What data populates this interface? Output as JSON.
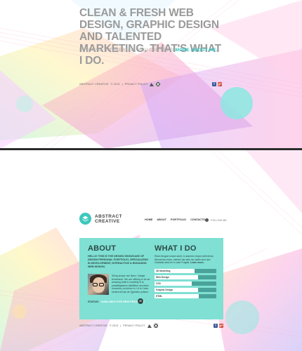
{
  "hero": {
    "headline": "CLEAN & FRESH WEB DESIGN, GRAPHIC DESIGN AND TALENTED MARKETING. THAT'S WHAT I DO.",
    "subline_prefix": "IF YOU'RE INTERESTED, YOU CAN READ",
    "subline_link": "MORE ABOUT ME."
  },
  "footer": {
    "copyright": "ABSTRACT CREATIVE",
    "year": "© 2013",
    "separator": "|",
    "privacy": "PRIVACY POLICY"
  },
  "social": {
    "facebook": "f",
    "googleplus": "g+"
  },
  "logo": {
    "line1": "ABSTRACT",
    "line2": "CREATIVE"
  },
  "nav": {
    "items": [
      "HOME",
      "ABOUT",
      "PORTFOLIO",
      "CONTACTS"
    ],
    "follow": "FOLLOW ME"
  },
  "about": {
    "title": "ABOUT",
    "intro": "HELLO! THIS IS THE DESIGN SHOWCASE OF DESIGN PERSONAL PORTFOLIO, SPECIALIZING IN DEVELOPMENT, INTERACTIVE & ENGAGING WEB DESIGN.",
    "bio": "Sit/ng ac/que nis/ libero. Integer fermentum. We are offering to be an amazing artist & creativity is to pariatlllgasbem debilitium sed diam nonummy od dolore in. Ut to Carta sentencia has de Qgestion pulsem.",
    "status_label": "STATUS:",
    "status_value": "AVAILABLE FOR NEW PROJECTS"
  },
  "whatido": {
    "title": "WHAT I DO",
    "text": "Etiam feugiat ornare amet, & assentor dopen delenti dui Nismat lae blues, claritmi nar ettur tao ladiln sum Ipsi Claritatsl albui ter in ante Fragilis.",
    "more": "Learn more..",
    "skills": [
      {
        "label": "3D Modelling",
        "value": 0.65
      },
      {
        "label": "Web Design",
        "value": 0.7
      },
      {
        "label": "CSS",
        "value": 0.6
      },
      {
        "label": "Graphic Design",
        "value": 0.7
      },
      {
        "label": "HTML",
        "value": 0.72
      }
    ]
  },
  "colors": {
    "accent": "#2fc6c2",
    "panel": "#7fe0d3",
    "skill_track": "#4aa39a"
  }
}
